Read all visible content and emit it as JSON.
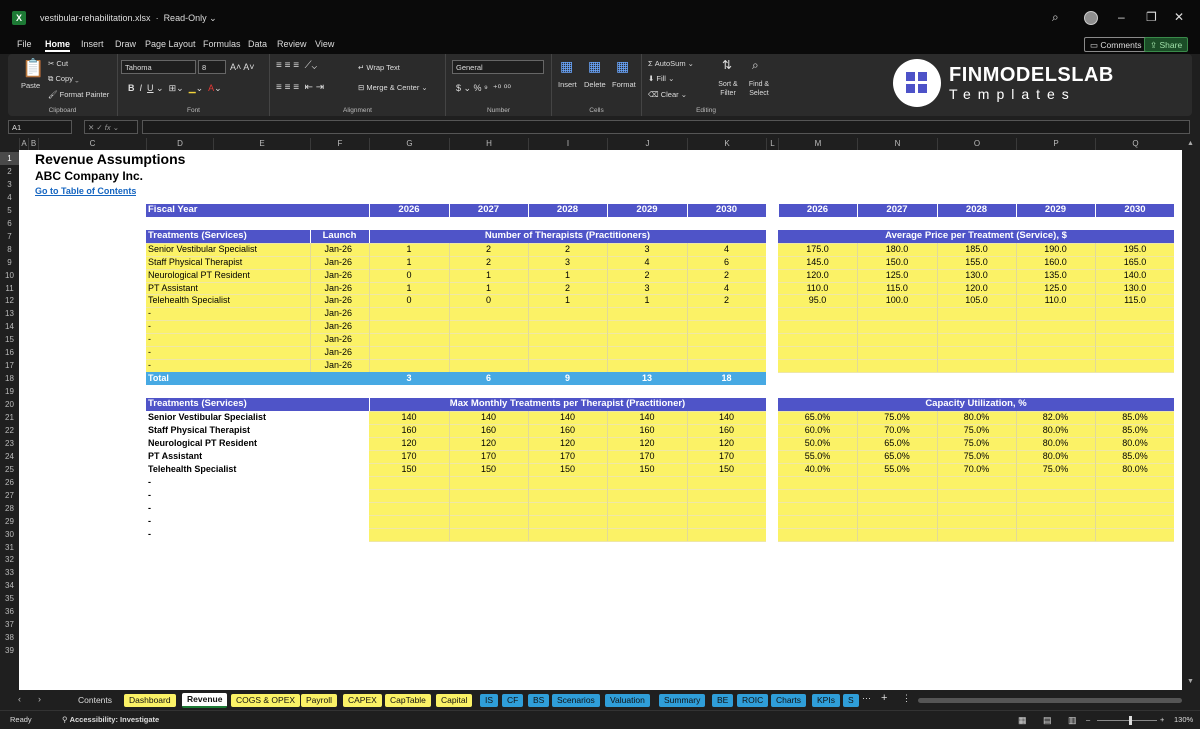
{
  "titlebar": {
    "filename": "vestibular-rehabilitation.xlsx",
    "mode": "Read-Only"
  },
  "menu": [
    "File",
    "Home",
    "Insert",
    "Draw",
    "Page Layout",
    "Formulas",
    "Data",
    "Review",
    "View"
  ],
  "top_buttons": {
    "comments": "Comments",
    "share": "Share"
  },
  "ribbon": {
    "paste": "Paste",
    "cut": "Cut",
    "copy": "Copy",
    "format_painter": "Format Painter",
    "clipboard": "Clipboard",
    "font_name": "Tahoma",
    "font_size": "8",
    "font": "Font",
    "wrap_text": "Wrap Text",
    "merge_center": "Merge & Center",
    "alignment": "Alignment",
    "number_format": "General",
    "number": "Number",
    "insert": "Insert",
    "delete": "Delete",
    "format": "Format",
    "cells": "Cells",
    "autosum": "AutoSum",
    "fill": "Fill",
    "clear": "Clear",
    "sort_filter": "Sort & Filter",
    "find_select": "Find & Select",
    "editing": "Editing"
  },
  "logo": {
    "line1": "FINMODELSLAB",
    "line2": "Templates"
  },
  "formula_bar": {
    "cell_ref": "A1",
    "fx": "fx"
  },
  "columns": [
    "A",
    "B",
    "C",
    "D",
    "E",
    "F",
    "G",
    "H",
    "I",
    "J",
    "K",
    "L",
    "M",
    "N",
    "O",
    "P",
    "Q"
  ],
  "rows": [
    "1",
    "2",
    "3",
    "4",
    "5",
    "6",
    "7",
    "8",
    "9",
    "10",
    "11",
    "12",
    "13",
    "14",
    "15",
    "16",
    "17",
    "18",
    "19",
    "20",
    "21",
    "22",
    "23",
    "24",
    "25",
    "26",
    "27",
    "28",
    "29",
    "30",
    "31",
    "32",
    "33",
    "34",
    "35",
    "36",
    "37",
    "38",
    "39"
  ],
  "sheet": {
    "title": "Revenue Assumptions",
    "company": "ABC Company Inc.",
    "toc_link": "Go to Table of Contents",
    "fiscal_year_label": "Fiscal Year",
    "years": [
      "2026",
      "2027",
      "2028",
      "2029",
      "2030"
    ],
    "section1": {
      "col1": "Treatments (Services)",
      "col2": "Launch",
      "head_left": "Number of Therapists (Practitioners)",
      "head_right": "Average Price per Treatment (Service), $"
    },
    "rows1": [
      {
        "name": "Senior Vestibular Specialist",
        "launch": "Jan-26",
        "therapists": [
          "1",
          "2",
          "2",
          "3",
          "4"
        ],
        "prices": [
          "175.0",
          "180.0",
          "185.0",
          "190.0",
          "195.0"
        ]
      },
      {
        "name": "Staff Physical Therapist",
        "launch": "Jan-26",
        "therapists": [
          "1",
          "2",
          "3",
          "4",
          "6"
        ],
        "prices": [
          "145.0",
          "150.0",
          "155.0",
          "160.0",
          "165.0"
        ]
      },
      {
        "name": "Neurological PT Resident",
        "launch": "Jan-26",
        "therapists": [
          "0",
          "1",
          "1",
          "2",
          "2"
        ],
        "prices": [
          "120.0",
          "125.0",
          "130.0",
          "135.0",
          "140.0"
        ]
      },
      {
        "name": "PT Assistant",
        "launch": "Jan-26",
        "therapists": [
          "1",
          "1",
          "2",
          "3",
          "4"
        ],
        "prices": [
          "110.0",
          "115.0",
          "120.0",
          "125.0",
          "130.0"
        ]
      },
      {
        "name": "Telehealth Specialist",
        "launch": "Jan-26",
        "therapists": [
          "0",
          "0",
          "1",
          "1",
          "2"
        ],
        "prices": [
          "95.0",
          "100.0",
          "105.0",
          "110.0",
          "115.0"
        ]
      },
      {
        "name": "-",
        "launch": "Jan-26",
        "therapists": [
          "",
          "",
          "",
          "",
          ""
        ],
        "prices": [
          "",
          "",
          "",
          "",
          ""
        ]
      },
      {
        "name": "-",
        "launch": "Jan-26",
        "therapists": [
          "",
          "",
          "",
          "",
          ""
        ],
        "prices": [
          "",
          "",
          "",
          "",
          ""
        ]
      },
      {
        "name": "-",
        "launch": "Jan-26",
        "therapists": [
          "",
          "",
          "",
          "",
          ""
        ],
        "prices": [
          "",
          "",
          "",
          "",
          ""
        ]
      },
      {
        "name": "-",
        "launch": "Jan-26",
        "therapists": [
          "",
          "",
          "",
          "",
          ""
        ],
        "prices": [
          "",
          "",
          "",
          "",
          ""
        ]
      },
      {
        "name": "-",
        "launch": "Jan-26",
        "therapists": [
          "",
          "",
          "",
          "",
          ""
        ],
        "prices": [
          "",
          "",
          "",
          "",
          ""
        ]
      }
    ],
    "total_label": "Total",
    "totals": [
      "3",
      "6",
      "9",
      "13",
      "18"
    ],
    "section2": {
      "col1": "Treatments (Services)",
      "head_left": "Max Monthly Treatments per Therapist (Practitioner)",
      "head_right": "Capacity Utilization, %"
    },
    "rows2": [
      {
        "name": "Senior Vestibular Specialist",
        "max": [
          "140",
          "140",
          "140",
          "140",
          "140"
        ],
        "util": [
          "65.0%",
          "75.0%",
          "80.0%",
          "82.0%",
          "85.0%"
        ]
      },
      {
        "name": "Staff Physical Therapist",
        "max": [
          "160",
          "160",
          "160",
          "160",
          "160"
        ],
        "util": [
          "60.0%",
          "70.0%",
          "75.0%",
          "80.0%",
          "85.0%"
        ]
      },
      {
        "name": "Neurological PT Resident",
        "max": [
          "120",
          "120",
          "120",
          "120",
          "120"
        ],
        "util": [
          "50.0%",
          "65.0%",
          "75.0%",
          "80.0%",
          "80.0%"
        ]
      },
      {
        "name": "PT Assistant",
        "max": [
          "170",
          "170",
          "170",
          "170",
          "170"
        ],
        "util": [
          "55.0%",
          "65.0%",
          "75.0%",
          "80.0%",
          "85.0%"
        ]
      },
      {
        "name": "Telehealth Specialist",
        "max": [
          "150",
          "150",
          "150",
          "150",
          "150"
        ],
        "util": [
          "40.0%",
          "55.0%",
          "70.0%",
          "75.0%",
          "80.0%"
        ]
      },
      {
        "name": "-",
        "max": [
          "",
          "",
          "",
          "",
          ""
        ],
        "util": [
          "",
          "",
          "",
          "",
          ""
        ]
      },
      {
        "name": "-",
        "max": [
          "",
          "",
          "",
          "",
          ""
        ],
        "util": [
          "",
          "",
          "",
          "",
          ""
        ]
      },
      {
        "name": "-",
        "max": [
          "",
          "",
          "",
          "",
          ""
        ],
        "util": [
          "",
          "",
          "",
          "",
          ""
        ]
      },
      {
        "name": "-",
        "max": [
          "",
          "",
          "",
          "",
          ""
        ],
        "util": [
          "",
          "",
          "",
          "",
          ""
        ]
      },
      {
        "name": "-",
        "max": [
          "",
          "",
          "",
          "",
          ""
        ],
        "util": [
          "",
          "",
          "",
          "",
          ""
        ]
      }
    ]
  },
  "tabs": [
    {
      "label": "Contents",
      "style": "plain"
    },
    {
      "label": "Dashboard",
      "style": "y"
    },
    {
      "label": "Revenue",
      "style": "active"
    },
    {
      "label": "COGS & OPEX",
      "style": "y"
    },
    {
      "label": "Payroll",
      "style": "y"
    },
    {
      "label": "CAPEX",
      "style": "y"
    },
    {
      "label": "CapTable",
      "style": "y"
    },
    {
      "label": "Capital",
      "style": "y"
    },
    {
      "label": "IS",
      "style": "b"
    },
    {
      "label": "CF",
      "style": "b"
    },
    {
      "label": "BS",
      "style": "b"
    },
    {
      "label": "Scenarios",
      "style": "b"
    },
    {
      "label": "Valuation",
      "style": "b"
    },
    {
      "label": "Summary",
      "style": "b"
    },
    {
      "label": "BE",
      "style": "b"
    },
    {
      "label": "ROIC",
      "style": "b"
    },
    {
      "label": "Charts",
      "style": "b"
    },
    {
      "label": "KPIs",
      "style": "b"
    },
    {
      "label": "S",
      "style": "b"
    }
  ],
  "status": {
    "ready": "Ready",
    "accessibility": "Accessibility: Investigate",
    "zoom": "130%"
  },
  "colors": {
    "header_blue": "#4f54c8",
    "input_yellow": "#fbf266",
    "total_blue": "#47a9e3",
    "link_blue": "#1565c0"
  }
}
